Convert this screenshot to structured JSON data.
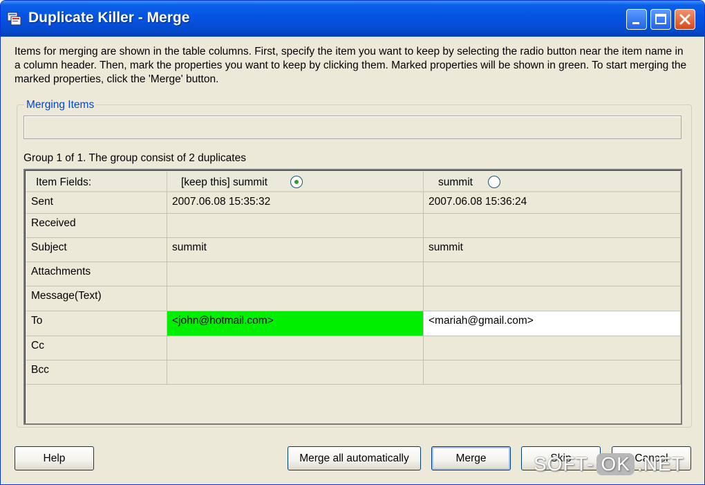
{
  "window": {
    "title": "Duplicate Killer - Merge"
  },
  "description": "Items for merging are shown in the table columns. First, specify the item you want to keep by selecting the radio button near the item name in a column header. Then, mark the properties you want to keep by clicking them. Marked properties will be shown in green. To start merging the marked properties, click the 'Merge' button.",
  "merging_items": {
    "legend": "Merging Items",
    "group_info": "Group 1 of 1. The group consist of 2 duplicates"
  },
  "table": {
    "headers": {
      "fields": "Item Fields:",
      "item1": "[keep this] summit",
      "item2": "summit"
    },
    "selected_item": 1,
    "rows": [
      {
        "field": "Sent",
        "v1": "2007.06.08 15:35:32",
        "v2": "2007.06.08 15:36:24"
      },
      {
        "field": "Received",
        "v1": "",
        "v2": ""
      },
      {
        "field": "Subject",
        "v1": "summit",
        "v2": "summit"
      },
      {
        "field": "Attachments",
        "v1": "",
        "v2": ""
      },
      {
        "field": "Message(Text)",
        "v1": "",
        "v2": ""
      },
      {
        "field": "To",
        "v1": "<john@hotmail.com>",
        "v2": "<mariah@gmail.com>"
      },
      {
        "field": "Cc",
        "v1": "",
        "v2": ""
      },
      {
        "field": "Bcc",
        "v1": "",
        "v2": ""
      }
    ],
    "marked_color": "#00ee00"
  },
  "buttons": {
    "help": "Help",
    "merge_all": "Merge all automatically",
    "merge": "Merge",
    "skip": "Skip",
    "cancel": "Cancel"
  },
  "watermark": {
    "left": "SOFT-",
    "ok": "OK",
    "right": ".NET"
  },
  "colors": {
    "titlebar": "#0551e0",
    "dialog_bg": "#ece9d8",
    "legend_text": "#0046d5"
  }
}
